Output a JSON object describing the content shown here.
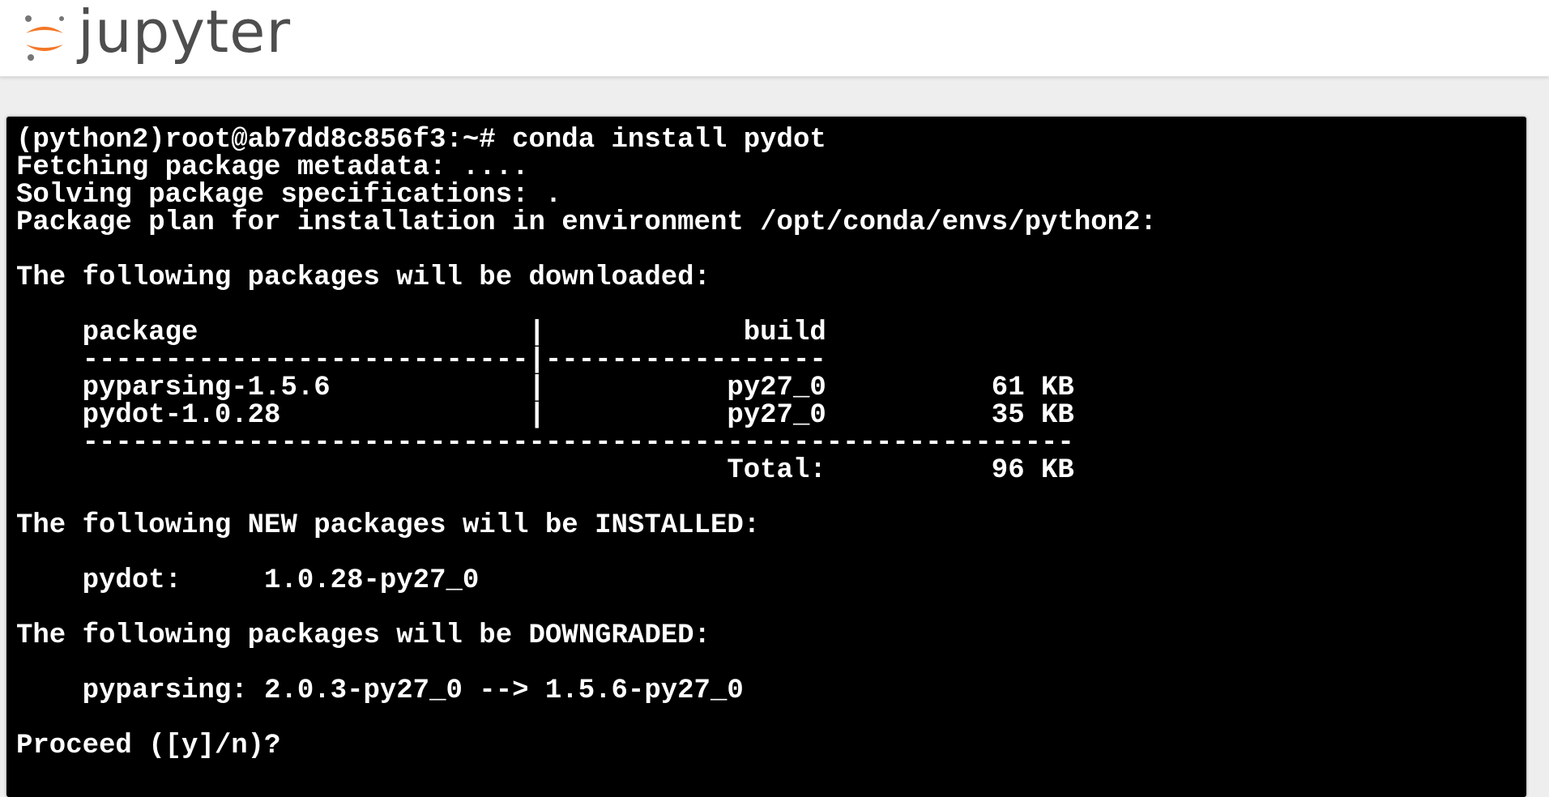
{
  "header": {
    "logo_text": "jupyter",
    "logo_icon": "jupyter-logo-icon",
    "colors": {
      "logo_orange": "#f37726",
      "logo_gray": "#767677",
      "logo_text": "#4e4e4e"
    }
  },
  "terminal": {
    "colors": {
      "background": "#000000",
      "foreground": "#ffffff"
    },
    "lines": [
      "(python2)root@ab7dd8c856f3:~# conda install pydot",
      "Fetching package metadata: ....",
      "Solving package specifications: .",
      "Package plan for installation in environment /opt/conda/envs/python2:",
      "",
      "The following packages will be downloaded:",
      "",
      "    package                    |            build",
      "    ---------------------------|-----------------",
      "    pyparsing-1.5.6            |           py27_0          61 KB",
      "    pydot-1.0.28               |           py27_0          35 KB",
      "    ------------------------------------------------------------",
      "                                           Total:          96 KB",
      "",
      "The following NEW packages will be INSTALLED:",
      "",
      "    pydot:     1.0.28-py27_0",
      "",
      "The following packages will be DOWNGRADED:",
      "",
      "    pyparsing: 2.0.3-py27_0 --> 1.5.6-py27_0",
      "",
      "Proceed ([y]/n)?"
    ]
  }
}
